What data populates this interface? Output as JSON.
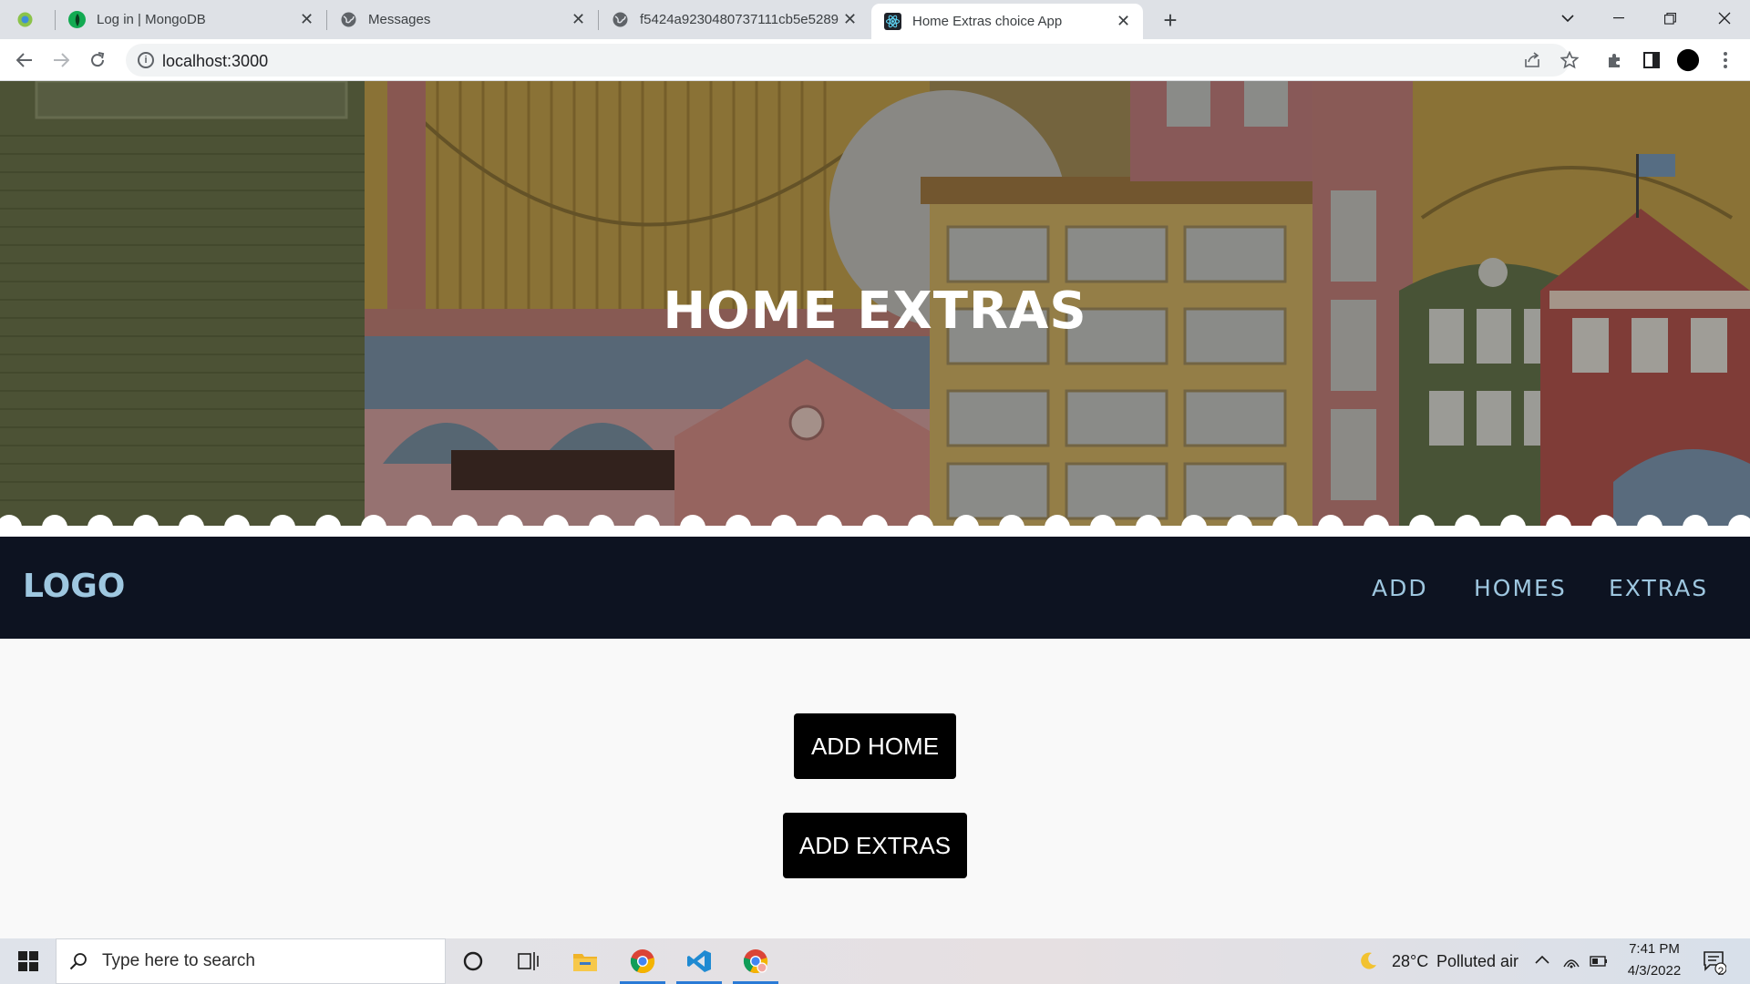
{
  "browser": {
    "tabs": [
      {
        "title": "",
        "favicon": "app-tab-icon"
      },
      {
        "title": "Log in | MongoDB",
        "favicon": "mongodb-leaf-icon"
      },
      {
        "title": "Messages",
        "favicon": "globe-icon"
      },
      {
        "title": "f5424a9230480737111cb5e5289",
        "favicon": "globe-icon"
      },
      {
        "title": "Home Extras choice App",
        "favicon": "react-icon"
      }
    ],
    "address": "localhost:3000"
  },
  "hero": {
    "title": "HOME EXTRAS"
  },
  "navbar": {
    "logo": "LOGO",
    "links": [
      "ADD",
      "HOMES",
      "EXTRAS"
    ]
  },
  "main": {
    "add_home_label": "ADD HOME",
    "add_extras_label": "ADD EXTRAS"
  },
  "taskbar": {
    "search_placeholder": "Type here to search",
    "weather_temp": "28°C",
    "weather_text": "Polluted air",
    "time": "7:41 PM",
    "date": "4/3/2022",
    "notification_count": "2"
  },
  "colors": {
    "navbar_bg": "#0d1321",
    "nav_text": "#9ec7e0",
    "button_bg": "#000000",
    "page_bg": "#f9f9f9"
  }
}
